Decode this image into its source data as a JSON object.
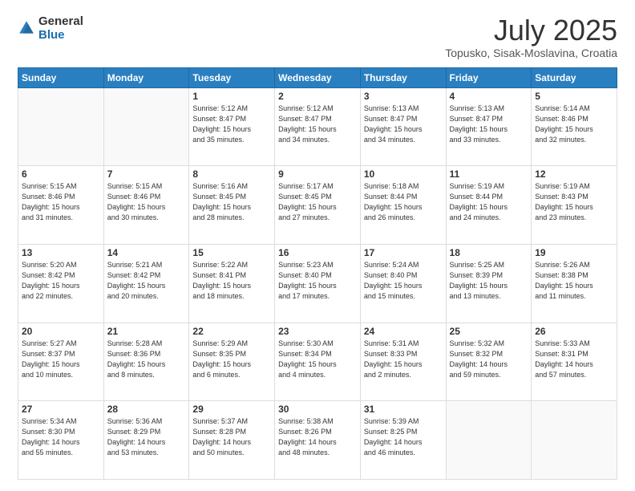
{
  "header": {
    "logo": {
      "general": "General",
      "blue": "Blue"
    },
    "title": "July 2025",
    "location": "Topusko, Sisak-Moslavina, Croatia"
  },
  "weekdays": [
    "Sunday",
    "Monday",
    "Tuesday",
    "Wednesday",
    "Thursday",
    "Friday",
    "Saturday"
  ],
  "weeks": [
    [
      {
        "day": "",
        "info": ""
      },
      {
        "day": "",
        "info": ""
      },
      {
        "day": "1",
        "info": "Sunrise: 5:12 AM\nSunset: 8:47 PM\nDaylight: 15 hours\nand 35 minutes."
      },
      {
        "day": "2",
        "info": "Sunrise: 5:12 AM\nSunset: 8:47 PM\nDaylight: 15 hours\nand 34 minutes."
      },
      {
        "day": "3",
        "info": "Sunrise: 5:13 AM\nSunset: 8:47 PM\nDaylight: 15 hours\nand 34 minutes."
      },
      {
        "day": "4",
        "info": "Sunrise: 5:13 AM\nSunset: 8:47 PM\nDaylight: 15 hours\nand 33 minutes."
      },
      {
        "day": "5",
        "info": "Sunrise: 5:14 AM\nSunset: 8:46 PM\nDaylight: 15 hours\nand 32 minutes."
      }
    ],
    [
      {
        "day": "6",
        "info": "Sunrise: 5:15 AM\nSunset: 8:46 PM\nDaylight: 15 hours\nand 31 minutes."
      },
      {
        "day": "7",
        "info": "Sunrise: 5:15 AM\nSunset: 8:46 PM\nDaylight: 15 hours\nand 30 minutes."
      },
      {
        "day": "8",
        "info": "Sunrise: 5:16 AM\nSunset: 8:45 PM\nDaylight: 15 hours\nand 28 minutes."
      },
      {
        "day": "9",
        "info": "Sunrise: 5:17 AM\nSunset: 8:45 PM\nDaylight: 15 hours\nand 27 minutes."
      },
      {
        "day": "10",
        "info": "Sunrise: 5:18 AM\nSunset: 8:44 PM\nDaylight: 15 hours\nand 26 minutes."
      },
      {
        "day": "11",
        "info": "Sunrise: 5:19 AM\nSunset: 8:44 PM\nDaylight: 15 hours\nand 24 minutes."
      },
      {
        "day": "12",
        "info": "Sunrise: 5:19 AM\nSunset: 8:43 PM\nDaylight: 15 hours\nand 23 minutes."
      }
    ],
    [
      {
        "day": "13",
        "info": "Sunrise: 5:20 AM\nSunset: 8:42 PM\nDaylight: 15 hours\nand 22 minutes."
      },
      {
        "day": "14",
        "info": "Sunrise: 5:21 AM\nSunset: 8:42 PM\nDaylight: 15 hours\nand 20 minutes."
      },
      {
        "day": "15",
        "info": "Sunrise: 5:22 AM\nSunset: 8:41 PM\nDaylight: 15 hours\nand 18 minutes."
      },
      {
        "day": "16",
        "info": "Sunrise: 5:23 AM\nSunset: 8:40 PM\nDaylight: 15 hours\nand 17 minutes."
      },
      {
        "day": "17",
        "info": "Sunrise: 5:24 AM\nSunset: 8:40 PM\nDaylight: 15 hours\nand 15 minutes."
      },
      {
        "day": "18",
        "info": "Sunrise: 5:25 AM\nSunset: 8:39 PM\nDaylight: 15 hours\nand 13 minutes."
      },
      {
        "day": "19",
        "info": "Sunrise: 5:26 AM\nSunset: 8:38 PM\nDaylight: 15 hours\nand 11 minutes."
      }
    ],
    [
      {
        "day": "20",
        "info": "Sunrise: 5:27 AM\nSunset: 8:37 PM\nDaylight: 15 hours\nand 10 minutes."
      },
      {
        "day": "21",
        "info": "Sunrise: 5:28 AM\nSunset: 8:36 PM\nDaylight: 15 hours\nand 8 minutes."
      },
      {
        "day": "22",
        "info": "Sunrise: 5:29 AM\nSunset: 8:35 PM\nDaylight: 15 hours\nand 6 minutes."
      },
      {
        "day": "23",
        "info": "Sunrise: 5:30 AM\nSunset: 8:34 PM\nDaylight: 15 hours\nand 4 minutes."
      },
      {
        "day": "24",
        "info": "Sunrise: 5:31 AM\nSunset: 8:33 PM\nDaylight: 15 hours\nand 2 minutes."
      },
      {
        "day": "25",
        "info": "Sunrise: 5:32 AM\nSunset: 8:32 PM\nDaylight: 14 hours\nand 59 minutes."
      },
      {
        "day": "26",
        "info": "Sunrise: 5:33 AM\nSunset: 8:31 PM\nDaylight: 14 hours\nand 57 minutes."
      }
    ],
    [
      {
        "day": "27",
        "info": "Sunrise: 5:34 AM\nSunset: 8:30 PM\nDaylight: 14 hours\nand 55 minutes."
      },
      {
        "day": "28",
        "info": "Sunrise: 5:36 AM\nSunset: 8:29 PM\nDaylight: 14 hours\nand 53 minutes."
      },
      {
        "day": "29",
        "info": "Sunrise: 5:37 AM\nSunset: 8:28 PM\nDaylight: 14 hours\nand 50 minutes."
      },
      {
        "day": "30",
        "info": "Sunrise: 5:38 AM\nSunset: 8:26 PM\nDaylight: 14 hours\nand 48 minutes."
      },
      {
        "day": "31",
        "info": "Sunrise: 5:39 AM\nSunset: 8:25 PM\nDaylight: 14 hours\nand 46 minutes."
      },
      {
        "day": "",
        "info": ""
      },
      {
        "day": "",
        "info": ""
      }
    ]
  ]
}
